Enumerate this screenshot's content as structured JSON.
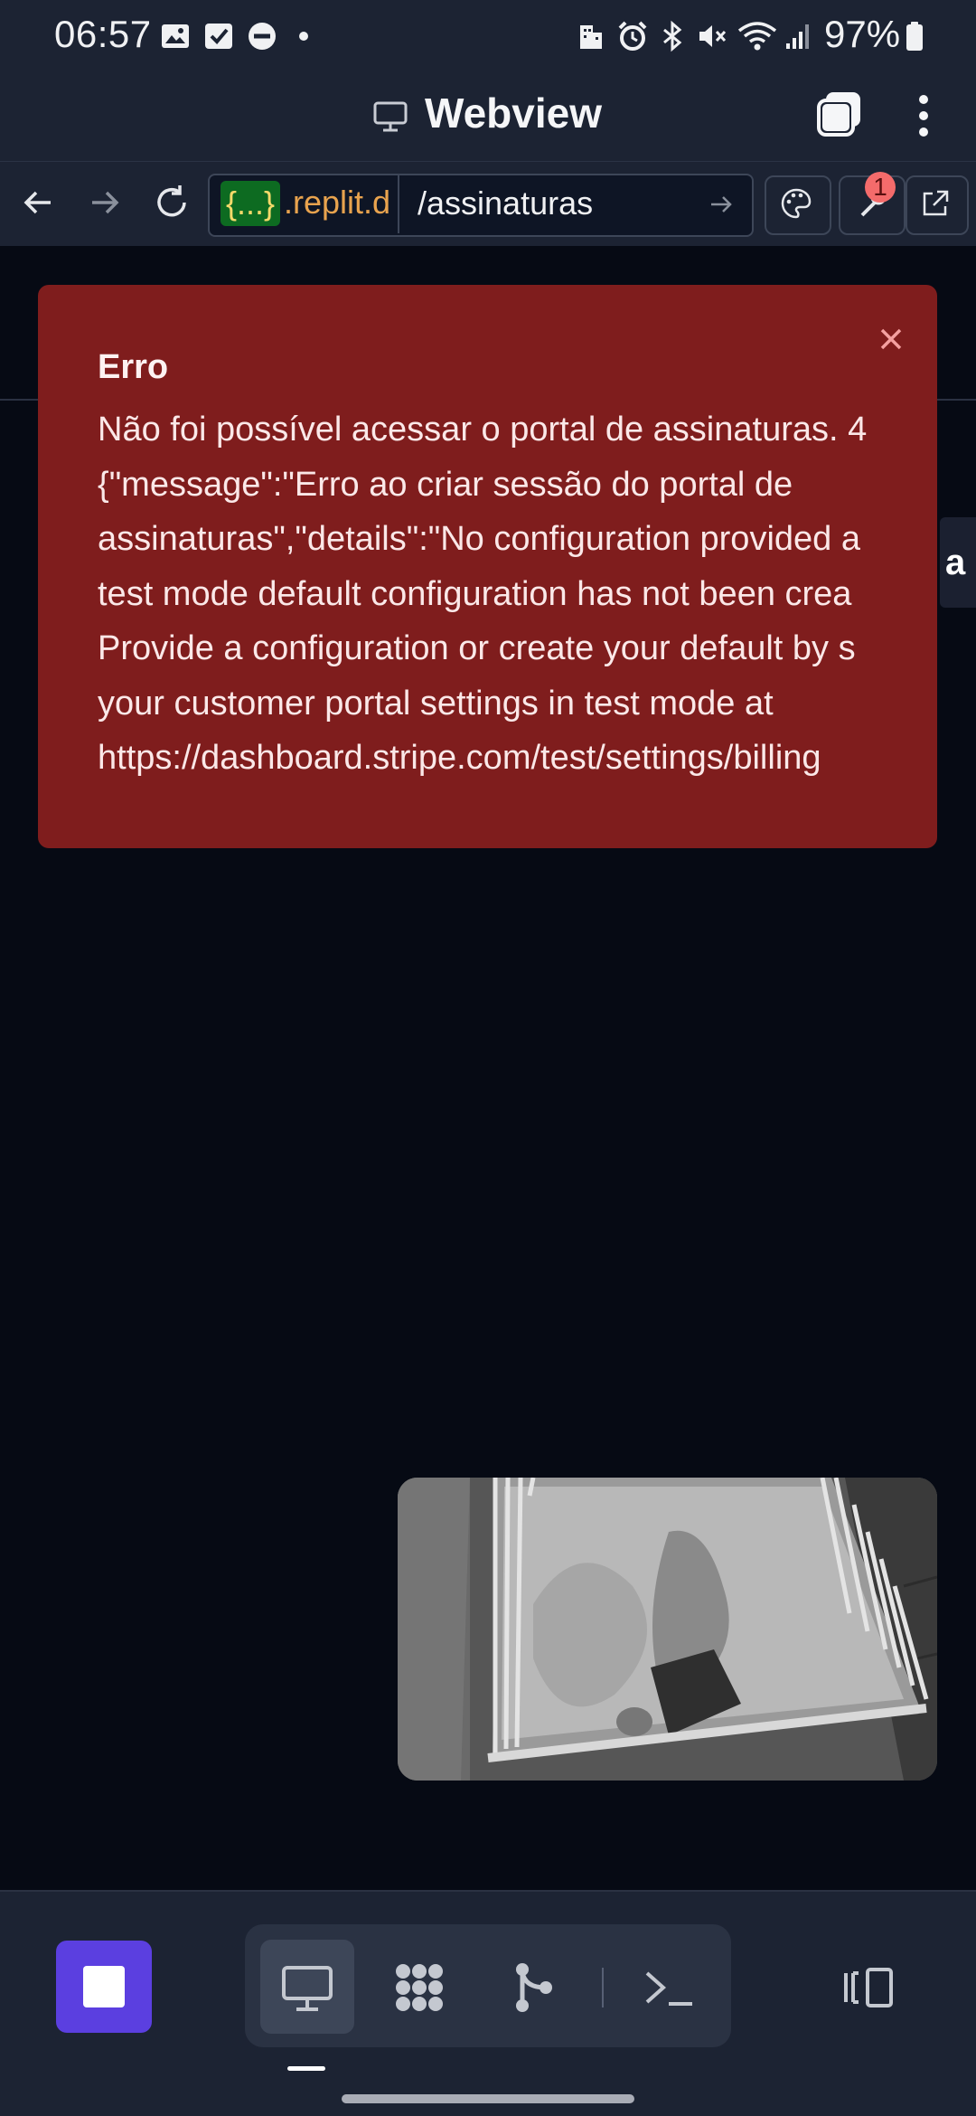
{
  "status_bar": {
    "time": "06:57",
    "battery": "97%",
    "icons": [
      "image-icon",
      "checkbox-icon",
      "dnd-icon",
      "dot-icon",
      "building-icon",
      "alarm-icon",
      "bluetooth-icon",
      "mute-icon",
      "wifi-icon",
      "signal-icon",
      "battery-icon"
    ]
  },
  "header": {
    "title": "Webview",
    "icons": [
      "monitor-icon",
      "tabs-icon",
      "menu-icon"
    ]
  },
  "address_bar": {
    "host_badge": "{...}",
    "host": ".replit.d",
    "path": "/assinaturas",
    "devtools_badge": "1"
  },
  "toast": {
    "title": "Erro",
    "body": "Não foi possível acessar o portal de assinaturas. 4\n{\"message\":\"Erro ao criar sessão do portal de\nassinaturas\",\"details\":\"No configuration provided a\ntest mode default configuration has not been crea\nProvide a configuration or create your default by s\nyour customer portal settings in test mode at\nhttps://dashboard.stripe.com/test/settings/billing"
  },
  "content": {
    "edge_tab_text": "a"
  },
  "bottom_toolbar": {
    "stop_label": "",
    "tools": [
      "webview-tool-icon",
      "packager-icon",
      "git-icon",
      "shell-icon"
    ],
    "layout_icon": "layout-icon"
  },
  "colors": {
    "background": "#1c2333",
    "content": "#060a14",
    "toast": "#7f1d1d",
    "stop_button": "#5b3fe0"
  }
}
